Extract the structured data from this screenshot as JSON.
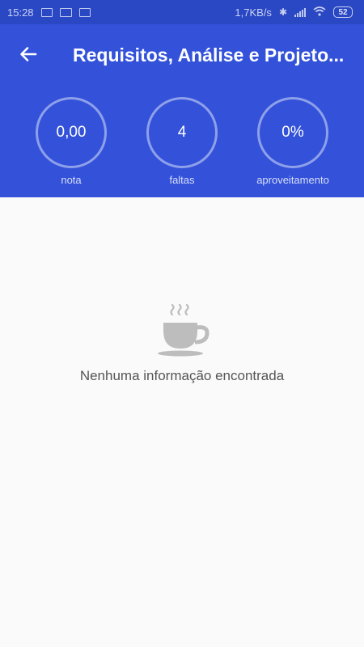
{
  "status_bar": {
    "time": "15:28",
    "network_speed": "1,7KB/s",
    "battery": "52",
    "icons": [
      "screen-icon",
      "mail-icon",
      "screen-icon",
      "bluetooth-icon",
      "signal-icon",
      "wifi-icon",
      "battery-icon"
    ]
  },
  "header": {
    "title": "Requisitos, Análise e Projeto...",
    "back_icon": "arrow-left-icon"
  },
  "stats": [
    {
      "value": "0,00",
      "label": "nota"
    },
    {
      "value": "4",
      "label": "faltas"
    },
    {
      "value": "0%",
      "label": "aproveitamento"
    }
  ],
  "empty_state": {
    "icon": "coffee-cup-icon",
    "message": "Nenhuma informação encontrada"
  },
  "colors": {
    "status_bar": "#2a48c4",
    "header": "#3352d9",
    "background": "#fafafa",
    "icon_gray": "#bdbdbd"
  }
}
